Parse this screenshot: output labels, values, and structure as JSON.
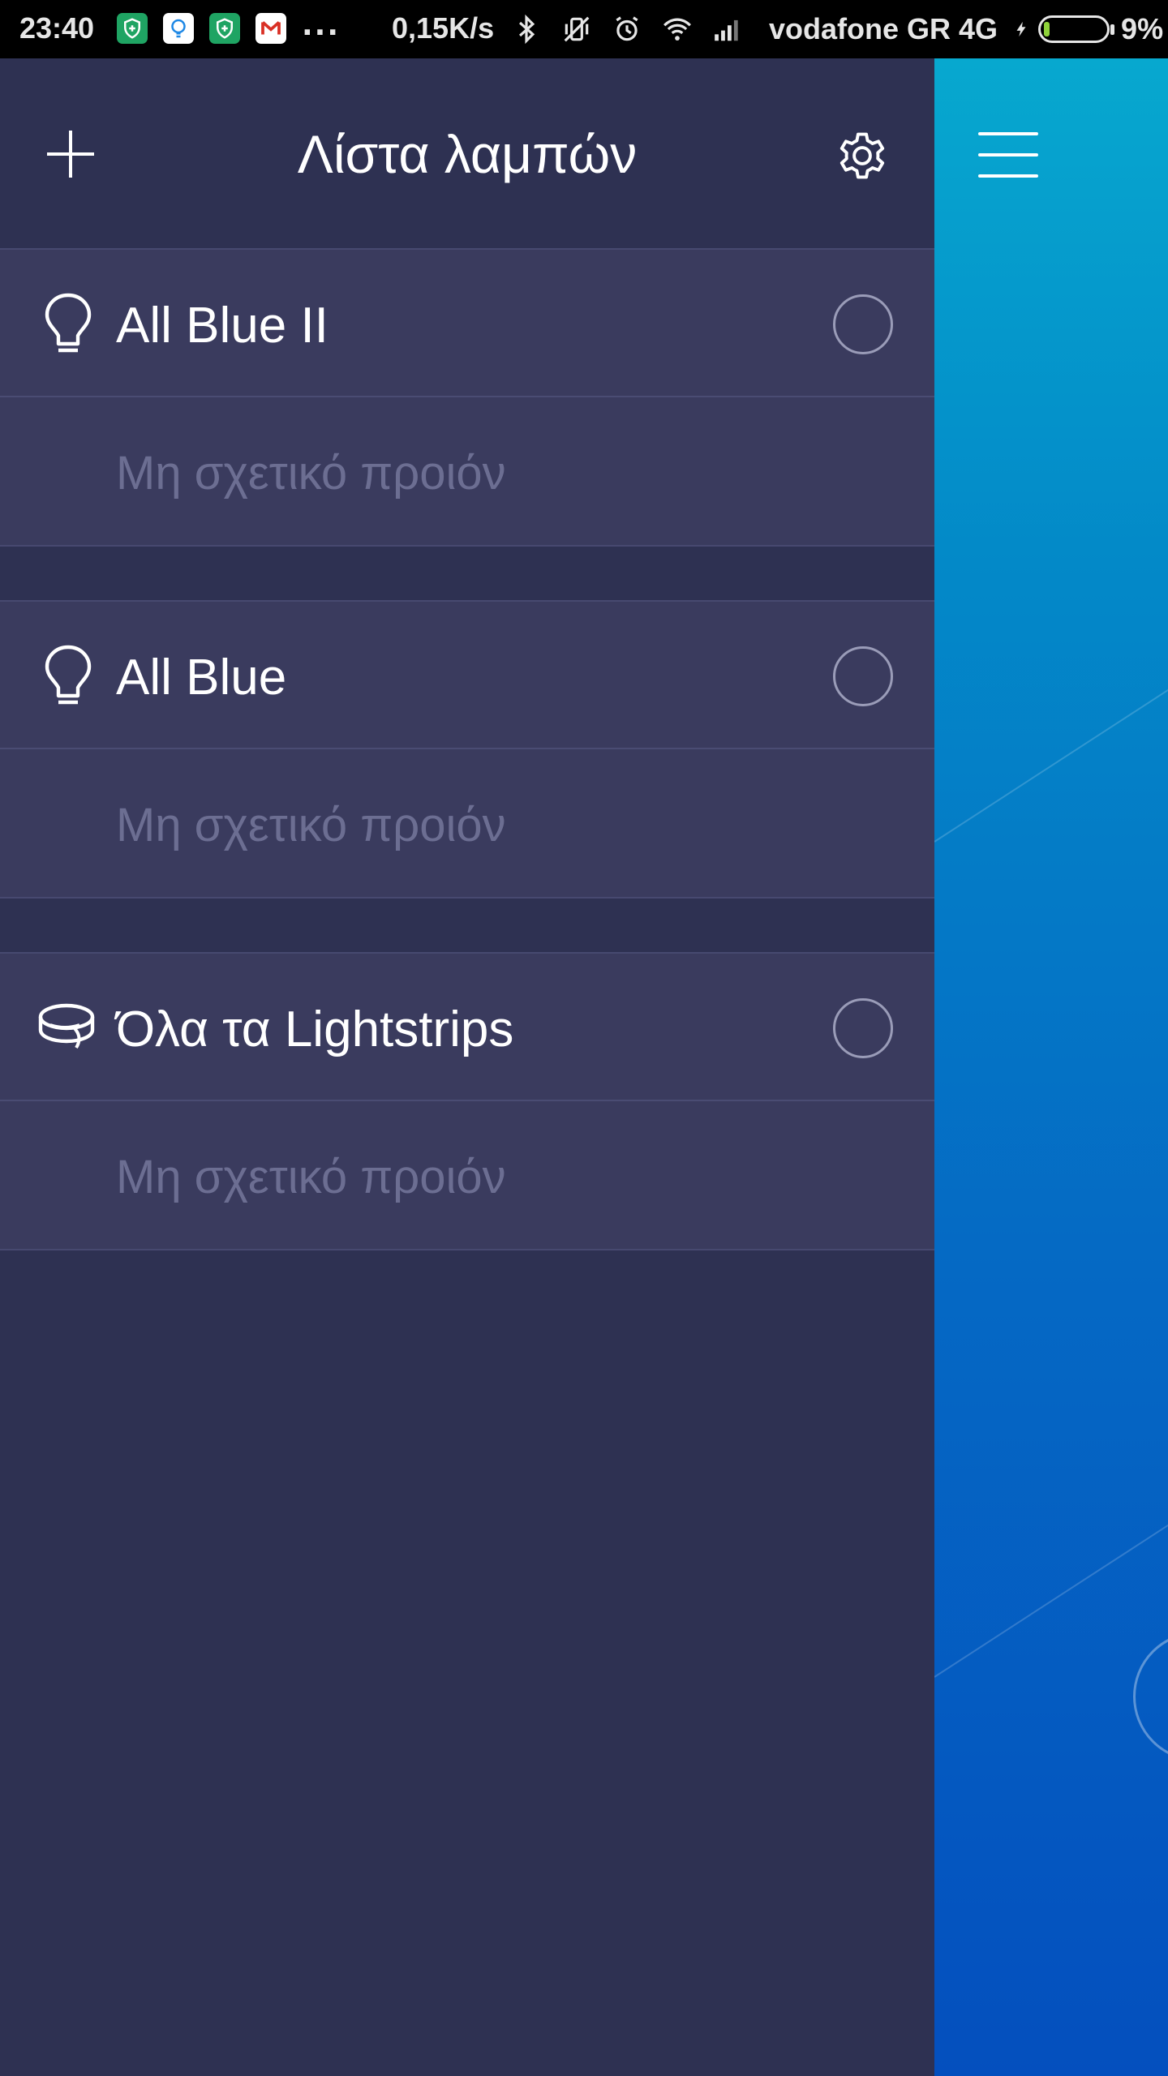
{
  "status_bar": {
    "time": "23:40",
    "more": "...",
    "speed": "0,15K/s",
    "carrier": "vodafone GR 4G",
    "battery_percent": "9%",
    "battery_level": 0.09,
    "icons": [
      "shield-notification-icon",
      "lightbulb-notification-icon",
      "shield-notification-icon",
      "gmail-icon",
      "bluetooth-icon",
      "vibrate-off-icon",
      "alarm-icon",
      "wifi-icon",
      "signal-icon",
      "charging-icon",
      "battery-icon"
    ]
  },
  "header": {
    "title": "Λίστα λαμπών",
    "add_icon": "plus-icon",
    "settings_icon": "gear-icon"
  },
  "lamps": [
    {
      "name": "All Blue II",
      "subtitle": "Μη σχετικό προιόν",
      "icon": "bulb-icon"
    },
    {
      "name": "All Blue",
      "subtitle": "Μη σχετικό προιόν",
      "icon": "bulb-icon"
    },
    {
      "name": "Όλα τα Lightstrips",
      "subtitle": "Μη σχετικό προιόν",
      "icon": "lightstrip-icon"
    }
  ],
  "main": {
    "menu_icon": "hamburger-menu-icon"
  },
  "colors": {
    "drawer_bg": "#2e3152",
    "group_bg": "#3a3b5e",
    "subtitle_text": "#6c6e92",
    "main_gradient_top": "#07a8cf",
    "main_gradient_bottom": "#044fbe"
  }
}
